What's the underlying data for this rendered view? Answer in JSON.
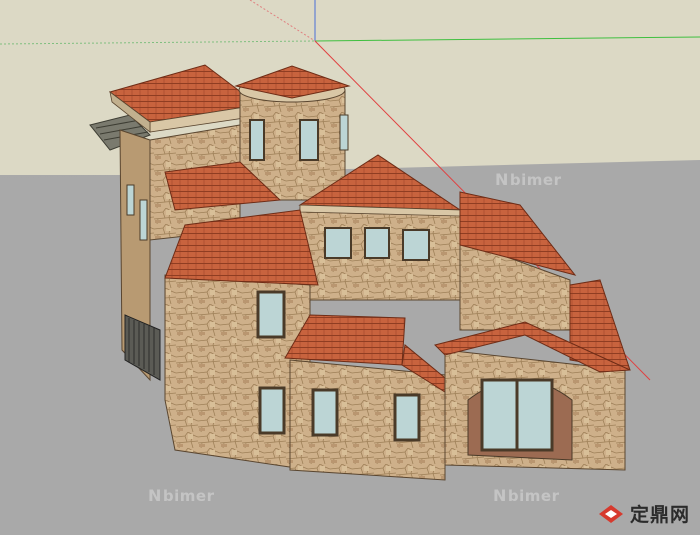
{
  "watermarks": [
    {
      "prefix": "N",
      "text": "bimer"
    },
    {
      "prefix": "N",
      "text": "bimer"
    },
    {
      "prefix": "N",
      "text": "bimer"
    }
  ],
  "brand": {
    "text": "定鼎网",
    "icon": "diamond-logo-icon"
  },
  "colors": {
    "sky": "#dcd9c5",
    "ground": "#a9a9a9",
    "roof": "#c5613d",
    "roof_dark": "#8e3b22",
    "stone": "#cdb08a",
    "stone_dark": "#a98a62",
    "trim": "#d9c7a6",
    "glass": "#bcd5d5",
    "axis_red": "#e04040",
    "axis_green": "#3fbf3f",
    "axis_blue": "#4a6fd8"
  }
}
